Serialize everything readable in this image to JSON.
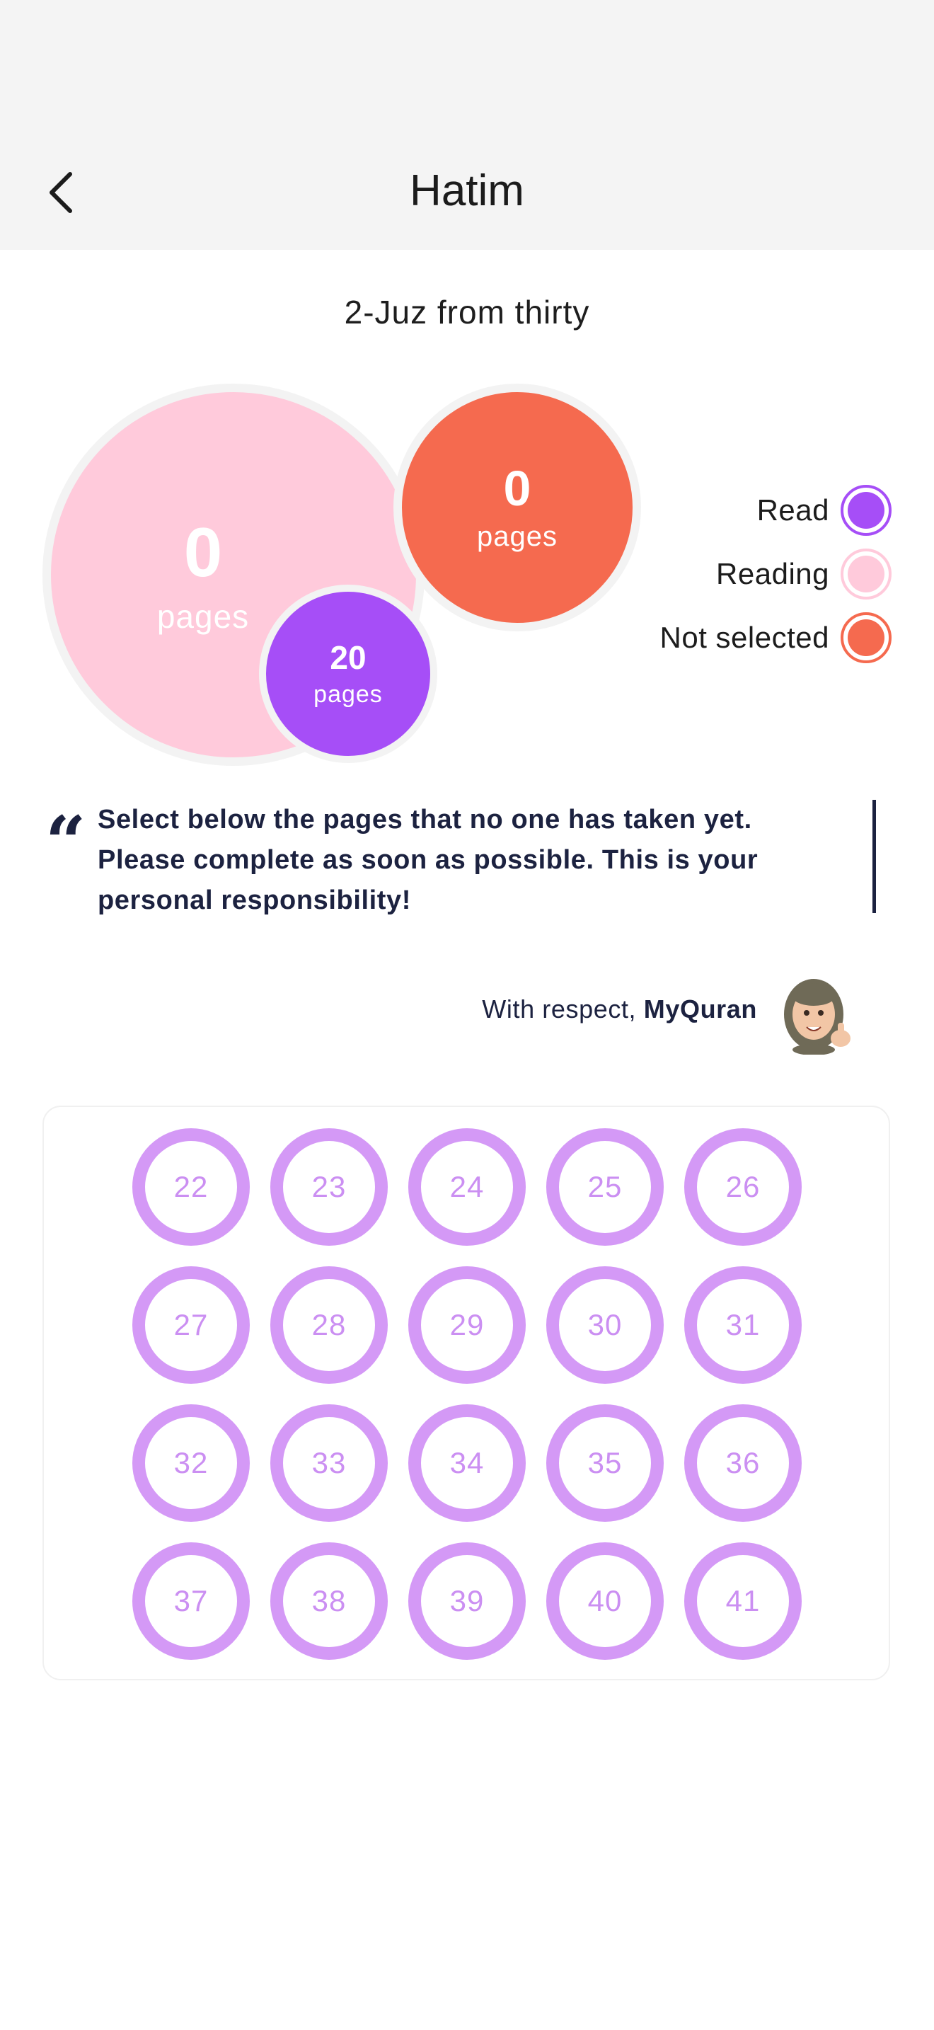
{
  "header": {
    "title": "Hatim"
  },
  "subtitle": "2-Juz from thirty",
  "stats": {
    "reading": {
      "value": "0",
      "unit": "pages"
    },
    "not_selected": {
      "value": "0",
      "unit": "pages"
    },
    "read": {
      "value": "20",
      "unit": "pages"
    }
  },
  "legend": [
    {
      "label": "Read",
      "color": "#a64ef7",
      "ring": "#a64ef7"
    },
    {
      "label": "Reading",
      "color": "#ffcadb",
      "ring": "#ffcadb"
    },
    {
      "label": "Not selected",
      "color": "#f56a4f",
      "ring": "#f56a4f"
    }
  ],
  "notice": {
    "text": "Select below the pages that no one has taken yet. Please complete as soon as possible. This is your personal responsibility!",
    "signature_prefix": "With respect,",
    "signature_name": "MyQuran"
  },
  "pages": [
    22,
    23,
    24,
    25,
    26,
    27,
    28,
    29,
    30,
    31,
    32,
    33,
    34,
    35,
    36,
    37,
    38,
    39,
    40,
    41
  ],
  "colors": {
    "header_bg": "#f4f4f4",
    "read": "#a64ef7",
    "reading": "#ffcadb",
    "not_selected": "#f56a4f",
    "page_ring": "#d499f6",
    "text_dark": "#1c2240"
  }
}
